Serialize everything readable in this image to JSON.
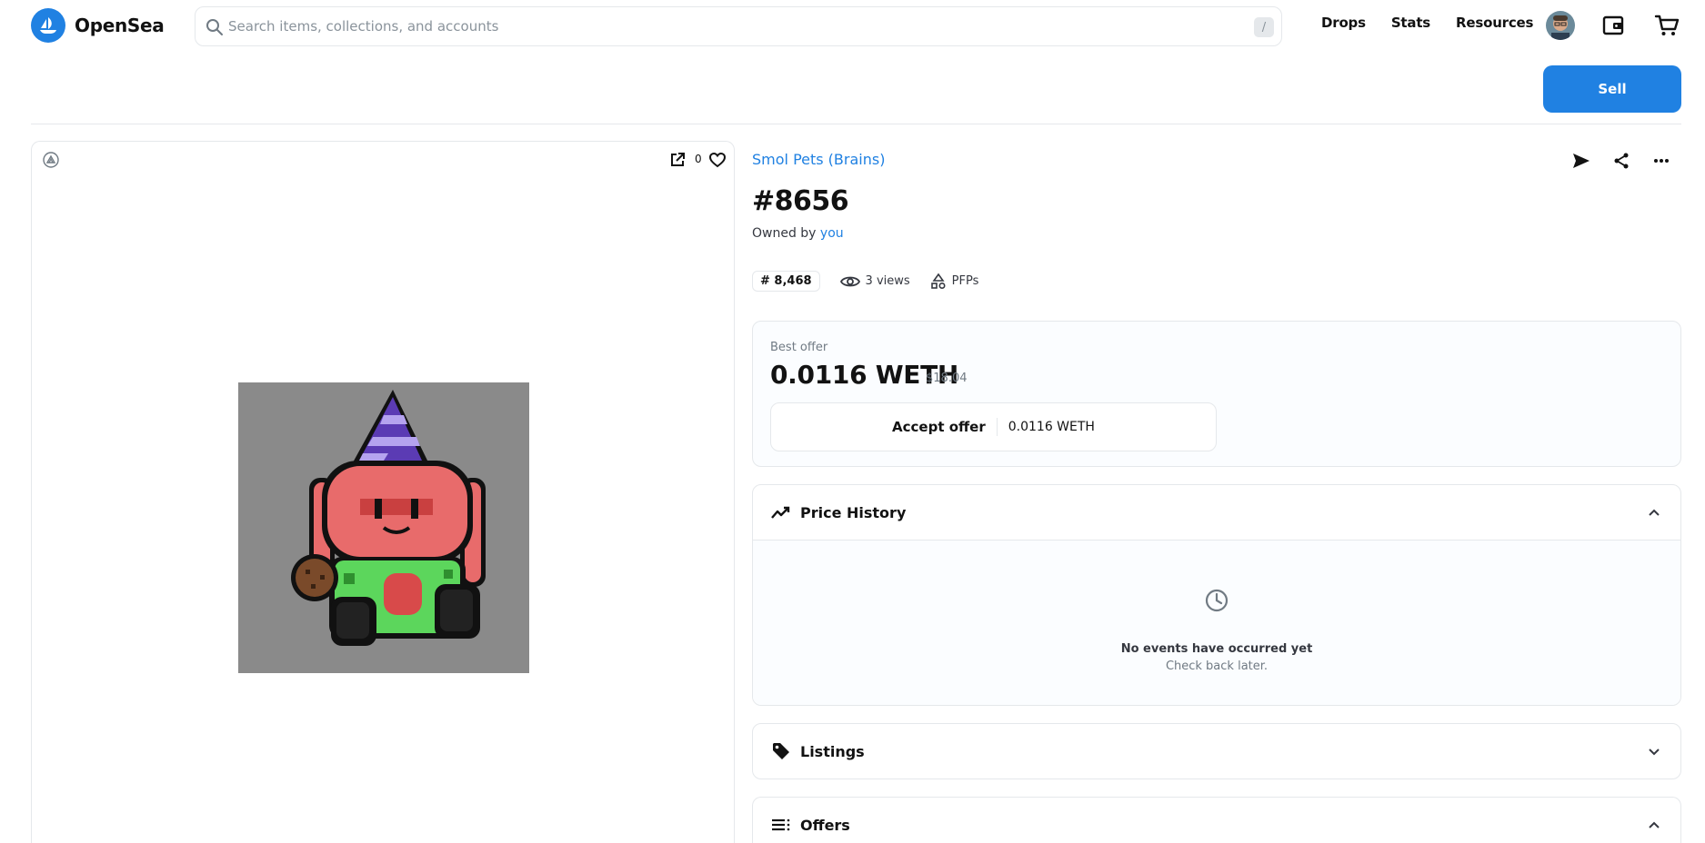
{
  "brand": {
    "name": "OpenSea",
    "color": "#2081e2"
  },
  "search": {
    "placeholder": "Search items, collections, and accounts",
    "value": "",
    "shortcut": "/"
  },
  "nav": {
    "items": [
      "Drops",
      "Stats",
      "Resources"
    ]
  },
  "actions": {
    "sell_label": "Sell"
  },
  "media": {
    "favorite_count": "0"
  },
  "item": {
    "collection": "Smol Pets (Brains)",
    "title": "#8656",
    "owned_by_label": "Owned by",
    "owner": "you",
    "rank": "# 8,468",
    "views": "3 views",
    "category": "PFPs"
  },
  "offer": {
    "best_label": "Best offer",
    "best_value": "0.0116 WETH",
    "best_usd": "$18.04",
    "accept_label": "Accept offer",
    "accept_amount": "0.0116 WETH"
  },
  "sections": {
    "price_history": {
      "title": "Price History",
      "empty_title": "No events have occurred yet",
      "empty_sub": "Check back later."
    },
    "listings": {
      "title": "Listings"
    },
    "offers": {
      "title": "Offers"
    }
  },
  "icons": [
    "search-icon",
    "wallet-icon",
    "cart-icon",
    "chain-icon",
    "open-in-new-icon",
    "heart-icon",
    "send-icon",
    "share-icon",
    "more-icon",
    "eye-icon",
    "shapes-icon",
    "trend-icon",
    "clock-icon",
    "tag-icon",
    "list-icon",
    "chevron-up-icon",
    "chevron-down-icon"
  ]
}
